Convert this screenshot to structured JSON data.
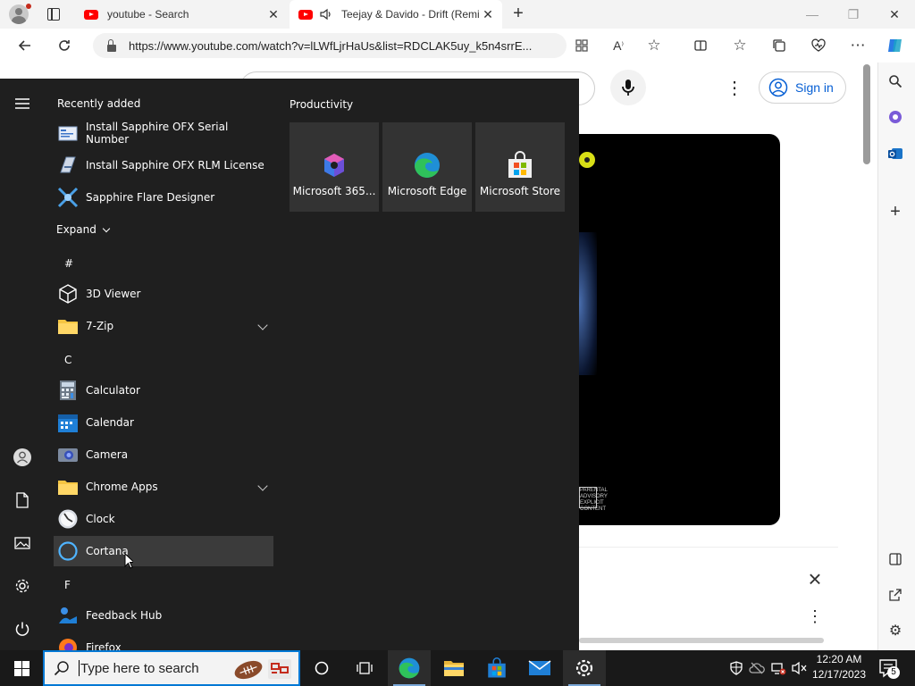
{
  "browser": {
    "tabs": [
      {
        "title": "youtube - Search",
        "close": "✕"
      },
      {
        "title": "Teejay & Davido - Drift (Remix)",
        "close": "✕"
      }
    ],
    "new_tab": "+",
    "window_controls": {
      "minimize": "—",
      "restore": "❐",
      "close": "✕"
    },
    "address": "https://www.youtube.com/watch?v=lLWfLjrHaUs&list=RDCLAK5uy_k5n4srrE..."
  },
  "youtube": {
    "sign_in": "Sign in",
    "advisory": "PARENTAL ADVISORY EXPLICIT CONTENT"
  },
  "start_menu": {
    "recently_added_title": "Recently added",
    "recently_added": [
      {
        "name": "Install Sapphire OFX Serial Number",
        "icon": "sapphire-serial-icon"
      },
      {
        "name": "Install Sapphire OFX RLM License",
        "icon": "sapphire-license-icon"
      },
      {
        "name": "Sapphire Flare Designer",
        "icon": "sapphire-flare-icon"
      }
    ],
    "expand_label": "Expand",
    "groups": [
      {
        "letter": "#",
        "apps": [
          {
            "name": "3D Viewer",
            "icon": "3d-viewer-icon"
          },
          {
            "name": "7-Zip",
            "icon": "folder-icon",
            "expandable": true
          }
        ]
      },
      {
        "letter": "C",
        "apps": [
          {
            "name": "Calculator",
            "icon": "calculator-icon"
          },
          {
            "name": "Calendar",
            "icon": "calendar-icon"
          },
          {
            "name": "Camera",
            "icon": "camera-icon"
          },
          {
            "name": "Chrome Apps",
            "icon": "folder-icon",
            "expandable": true
          },
          {
            "name": "Clock",
            "icon": "clock-icon"
          },
          {
            "name": "Cortana",
            "icon": "cortana-icon",
            "hover": true
          }
        ]
      },
      {
        "letter": "F",
        "apps": [
          {
            "name": "Feedback Hub",
            "icon": "feedback-hub-icon"
          },
          {
            "name": "Firefox",
            "icon": "firefox-icon"
          }
        ]
      }
    ],
    "tiles_title": "Productivity",
    "tiles": [
      {
        "label": "Microsoft 365...",
        "icon": "microsoft-365-icon"
      },
      {
        "label": "Microsoft Edge",
        "icon": "edge-icon"
      },
      {
        "label": "Microsoft Store",
        "icon": "store-icon"
      }
    ]
  },
  "taskbar": {
    "search_placeholder": "Type here to search",
    "time": "12:20 AM",
    "date": "12/17/2023",
    "notification_count": "5"
  },
  "colors": {
    "start_bg": "#1f1f1f",
    "tile_bg": "#333333",
    "taskbar_bg": "#191919",
    "accent": "#0078d4",
    "youtube_red": "#ff0000",
    "signin_blue": "#065fd4"
  }
}
